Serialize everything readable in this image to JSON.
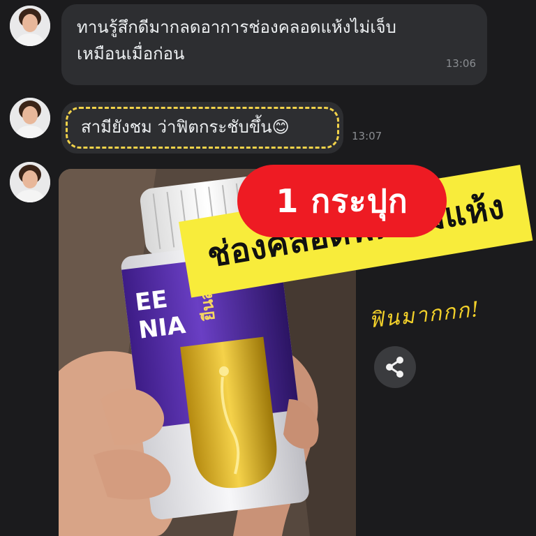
{
  "messages": [
    {
      "line1": "ทานรู้สึกดีมากลดอาการช่องคลอดแห้งไม่เจ็บ",
      "line2": "เหมือนเมื่อก่อน",
      "time": "13:06"
    },
    {
      "text": "สามียังชม ว่าฟิตกระชับขึ้น",
      "emoji": "😊",
      "time": "13:07"
    }
  ],
  "photo": {
    "bottle_label_left": "EE\nNIA",
    "bottle_label_brand": "ยีนส์"
  },
  "overlay": {
    "badge": "1 กระปุก",
    "headline": "ช่องคลอดฟิต ไม่แห้ง",
    "handwritten": "ฟินมากกก!"
  },
  "colors": {
    "background": "#1b1b1d",
    "bubble": "#2d2e31",
    "red_badge": "#ee1b23",
    "yellow_band": "#f8ec3b",
    "accent_yellow": "#f2d34a"
  },
  "icons": {
    "share": "share-icon"
  }
}
